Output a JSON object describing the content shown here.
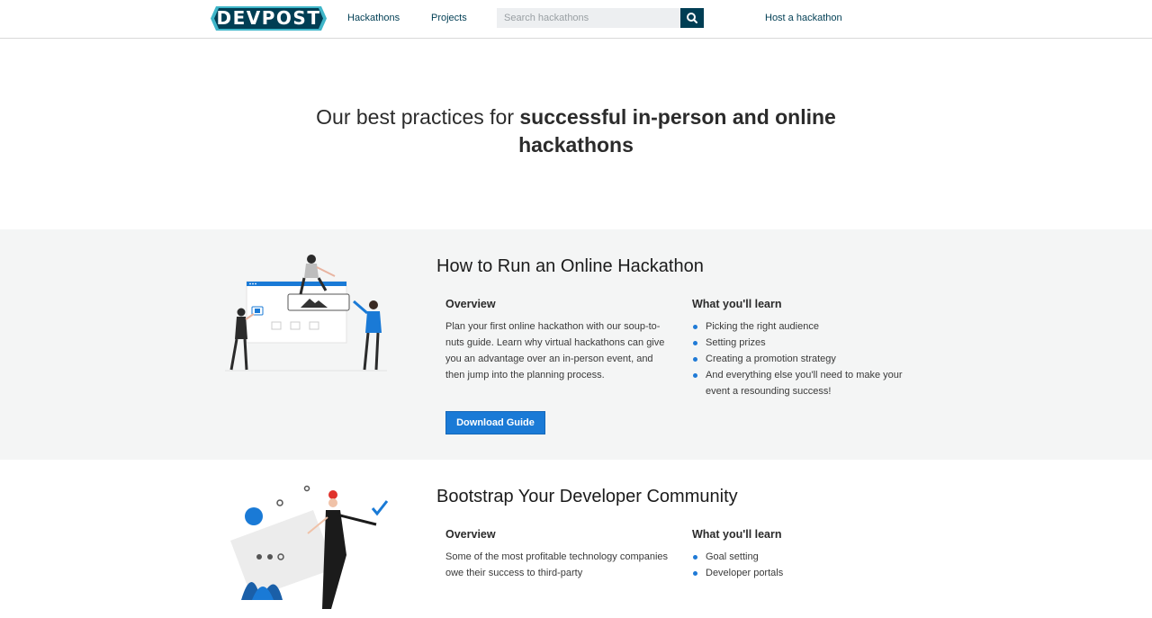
{
  "header": {
    "logo_text": "DEVPOST",
    "nav": {
      "hackathons": "Hackathons",
      "projects": "Projects",
      "host": "Host a hackathon"
    },
    "search": {
      "placeholder": "Search hackathons",
      "icon": "search-icon"
    },
    "colors": {
      "brand": "#003e54",
      "logo_bg": "#003e54",
      "logo_accent": "#3fb6c9"
    }
  },
  "hero": {
    "title_regular": "Our best practices for ",
    "title_bold": "successful in-person and online hackathons"
  },
  "guides": [
    {
      "title": "How to Run an Online Hackathon",
      "overview_heading": "Overview",
      "overview_text": "Plan your first online hackathon with our soup-to-nuts guide. Learn why virtual hackathons can give you an advantage over an in-person event, and then jump into the planning process.",
      "learn_heading": "What you'll learn",
      "learn_items": [
        "Picking the right audience",
        "Setting prizes",
        "Creating a promotion strategy",
        "And everything else you'll need to make your event a resounding success!"
      ],
      "button_label": "Download Guide"
    },
    {
      "title": "Bootstrap Your Developer Community",
      "overview_heading": "Overview",
      "overview_text": "Some of the most profitable technology companies owe their success to third-party",
      "learn_heading": "What you'll learn",
      "learn_items": [
        "Goal setting",
        "Developer portals"
      ]
    }
  ],
  "colors": {
    "accent": "#1a7ad6",
    "section_bg": "#f4f5f5"
  }
}
